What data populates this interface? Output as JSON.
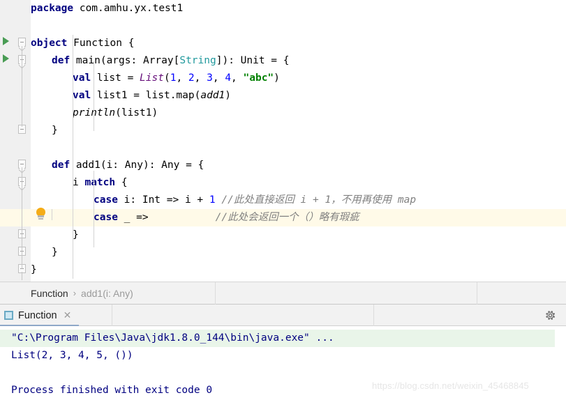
{
  "editor": {
    "lines": [
      {
        "indent": 0,
        "segments": [
          {
            "t": "package",
            "c": "kw"
          },
          {
            "t": " com.amhu.yx.test1",
            "c": "plain"
          }
        ]
      },
      {
        "indent": 0,
        "segments": []
      },
      {
        "indent": 0,
        "segments": [
          {
            "t": "object",
            "c": "kw"
          },
          {
            "t": " Function {",
            "c": "plain"
          }
        ]
      },
      {
        "indent": 1,
        "segments": [
          {
            "t": "def",
            "c": "kw"
          },
          {
            "t": " main(args: Array[",
            "c": "plain"
          },
          {
            "t": "String",
            "c": "type"
          },
          {
            "t": "]): Unit = {",
            "c": "plain"
          }
        ]
      },
      {
        "indent": 2,
        "segments": [
          {
            "t": "val",
            "c": "kw"
          },
          {
            "t": " list = ",
            "c": "plain"
          },
          {
            "t": "List",
            "c": "obj"
          },
          {
            "t": "(",
            "c": "plain"
          },
          {
            "t": "1",
            "c": "num"
          },
          {
            "t": ", ",
            "c": "plain"
          },
          {
            "t": "2",
            "c": "num"
          },
          {
            "t": ", ",
            "c": "plain"
          },
          {
            "t": "3",
            "c": "num"
          },
          {
            "t": ", ",
            "c": "plain"
          },
          {
            "t": "4",
            "c": "num"
          },
          {
            "t": ", ",
            "c": "plain"
          },
          {
            "t": "\"abc\"",
            "c": "str"
          },
          {
            "t": ")",
            "c": "plain"
          }
        ]
      },
      {
        "indent": 2,
        "segments": [
          {
            "t": "val",
            "c": "kw"
          },
          {
            "t": " list1 = list.map(",
            "c": "plain"
          },
          {
            "t": "add1",
            "c": "fn"
          },
          {
            "t": ")",
            "c": "plain"
          }
        ]
      },
      {
        "indent": 2,
        "segments": [
          {
            "t": "println",
            "c": "fn"
          },
          {
            "t": "(list1)",
            "c": "plain"
          }
        ]
      },
      {
        "indent": 1,
        "segments": [
          {
            "t": "}",
            "c": "plain"
          }
        ]
      },
      {
        "indent": 0,
        "segments": []
      },
      {
        "indent": 1,
        "segments": [
          {
            "t": "def",
            "c": "kw"
          },
          {
            "t": " add1(i: Any): Any = {",
            "c": "plain"
          }
        ]
      },
      {
        "indent": 2,
        "segments": [
          {
            "t": "i ",
            "c": "plain"
          },
          {
            "t": "match",
            "c": "kw"
          },
          {
            "t": " {",
            "c": "plain"
          }
        ]
      },
      {
        "indent": 3,
        "segments": [
          {
            "t": "case",
            "c": "kw"
          },
          {
            "t": " i: Int => i + ",
            "c": "plain"
          },
          {
            "t": "1",
            "c": "num"
          },
          {
            "t": " ",
            "c": "plain"
          },
          {
            "t": "//此处直接返回 i + 1，不用再使用 map",
            "c": "cmt"
          }
        ]
      },
      {
        "indent": 3,
        "highlight": true,
        "segments": [
          {
            "t": "case",
            "c": "kw"
          },
          {
            "t": " _ =>           ",
            "c": "plain"
          },
          {
            "t": "//此处会返回一个（）略有瑕疵",
            "c": "cmt"
          }
        ]
      },
      {
        "indent": 2,
        "segments": [
          {
            "t": "}",
            "c": "plain"
          }
        ]
      },
      {
        "indent": 1,
        "segments": [
          {
            "t": "}",
            "c": "plain"
          }
        ]
      },
      {
        "indent": 0,
        "segments": [
          {
            "t": "}",
            "c": "plain"
          }
        ]
      }
    ],
    "gutter": {
      "run_markers": [
        {
          "line": 2,
          "title": "run-object"
        },
        {
          "line": 3,
          "title": "run-main"
        }
      ],
      "intention_bulb": {
        "line": 12,
        "name": "intention-lightbulb"
      }
    }
  },
  "breadcrumb": {
    "items": [
      {
        "label": "Function",
        "dim": false
      },
      {
        "label": "add1(i: Any)",
        "dim": true
      }
    ],
    "separator": "›"
  },
  "run_panel": {
    "tab": {
      "label": "Function",
      "close": "✕"
    },
    "settings_icon": "gear-icon",
    "console": {
      "command_line": "\"C:\\Program Files\\Java\\jdk1.8.0_144\\bin\\java.exe\" ...",
      "output_lines": [
        "List(2, 3, 4, 5, ())",
        "",
        "Process finished with exit code 0"
      ]
    }
  },
  "watermark": {
    "text": "https://blog.csdn.net/weixin_45468845"
  },
  "colors": {
    "keyword": "#000080",
    "type": "#20999d",
    "number": "#0000ff",
    "string": "#008000",
    "object": "#660e7a",
    "comment": "#808080",
    "highlight_line": "#fffae8",
    "console_command_bg": "#e9f5e9",
    "console_text": "#000080",
    "run_marker_green": "#499c54",
    "bulb_yellow": "#f5ac16"
  }
}
